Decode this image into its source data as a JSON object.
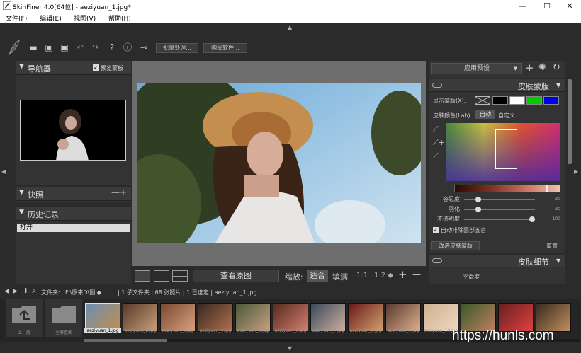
{
  "window": {
    "title": "SkinFiner 4.0[64位] - aeziyuan_1.jpg*",
    "minimize_label": "—",
    "maximize_label": "☐",
    "close_label": "✕"
  },
  "menu": {
    "items": [
      "文件(F)",
      "编辑(E)",
      "视图(V)",
      "帮助(H)"
    ]
  },
  "toolbar": {
    "icons": [
      "open-folder-icon",
      "save-icon",
      "save-as-icon",
      "undo-icon",
      "redo-icon",
      "help-icon",
      "info-icon",
      "plugin-icon"
    ],
    "batch_label": "批量处理...",
    "buy_label": "购买软件..."
  },
  "left_panel": {
    "navigator_title": "导航器",
    "preview_mask_label": "预览蒙板",
    "preview_mask_checked": true,
    "snapshot_title": "快照",
    "snapshot_controls": "—+",
    "history_title": "历史记录",
    "history_items": [
      "打开"
    ]
  },
  "view_bar": {
    "compare_label": "查看原图",
    "zoom_label": "缩放:",
    "fit_label": "适合",
    "fill_label": "填满",
    "ratio_1_1": "1:1",
    "ratio_1_2": "1:2 ◆",
    "plus": "+",
    "minus": "—"
  },
  "right_panel": {
    "preset_label": "应用预设",
    "skin_mask_title": "皮肤蒙版",
    "display_mask_label": "显示蒙版(X):",
    "skin_color_label": "皮肤颜色(Lab):",
    "auto_label": "自动",
    "custom_label": "自定义",
    "mask_colors": [
      "#000000",
      "#ffffff",
      "#00cc00",
      "#0000ee"
    ],
    "sliders": [
      {
        "label": "容忍度",
        "value": "30",
        "fraction": 0.2
      },
      {
        "label": "羽化",
        "value": "30",
        "fraction": 0.2
      },
      {
        "label": "不透明度",
        "value": "100",
        "fraction": 0.96
      }
    ],
    "auto_exclude_label": "自动排除面部五官",
    "auto_exclude_checked": true,
    "improve_mask_label": "改进皮肤蒙版",
    "reset_label": "重置",
    "skin_detail_title": "皮肤细节",
    "smoothness_label": "平滑度"
  },
  "path_bar": {
    "folder_label": "文件夹:",
    "path": "F:\\原来D\\图 ◆",
    "status": "| 1 子文件夹 | 68 张照片 | 1 已选定 | aeziyuan_1.jpg"
  },
  "filmstrip": {
    "up_label": "上一层",
    "all_label": "全屏查阅",
    "thumbs": [
      "aeziyuan_1.jpg",
      "aeziyuan_2.jpg",
      "aeziyuan_3.jpg",
      "aeziyuan_4.jpg",
      "aeziyuan_5.jpg",
      "aeziyuan_6.jpg",
      "aeziyuan_7.jpg",
      "aeziyuan_8.jpg",
      "aeziyuan_9.jpg",
      "aeziyuan_10.jpg",
      "",
      "",
      ""
    ]
  },
  "watermark": "https://hunls.com"
}
